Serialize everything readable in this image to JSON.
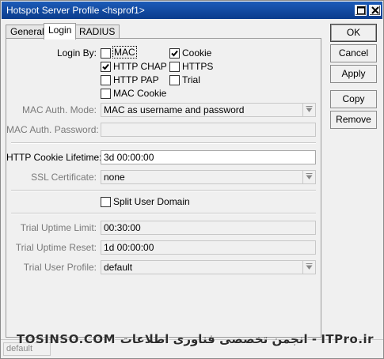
{
  "window": {
    "title": "Hotspot Server Profile <hsprof1>"
  },
  "tabs": [
    {
      "label": "General",
      "active": false
    },
    {
      "label": "Login",
      "active": true
    },
    {
      "label": "RADIUS",
      "active": false
    }
  ],
  "login_by": {
    "label": "Login By:",
    "options": [
      {
        "label": "MAC",
        "checked": false
      },
      {
        "label": "Cookie",
        "checked": true
      },
      {
        "label": "HTTP CHAP",
        "checked": true
      },
      {
        "label": "HTTPS",
        "checked": false
      },
      {
        "label": "HTTP PAP",
        "checked": false
      },
      {
        "label": "Trial",
        "checked": false
      },
      {
        "label": "MAC Cookie",
        "checked": false
      }
    ]
  },
  "mac_auth_mode": {
    "label": "MAC Auth. Mode:",
    "value": "MAC as username and password"
  },
  "mac_auth_password": {
    "label": "MAC Auth. Password:",
    "value": ""
  },
  "http_cookie_lifetime": {
    "label": "HTTP Cookie Lifetime:",
    "value": "3d 00:00:00"
  },
  "ssl_certificate": {
    "label": "SSL Certificate:",
    "value": "none"
  },
  "split_user_domain": {
    "label": "Split User Domain",
    "checked": false
  },
  "trial_uptime_limit": {
    "label": "Trial Uptime Limit:",
    "value": "00:30:00"
  },
  "trial_uptime_reset": {
    "label": "Trial Uptime Reset:",
    "value": "1d 00:00:00"
  },
  "trial_user_profile": {
    "label": "Trial User Profile:",
    "value": "default"
  },
  "buttons": {
    "ok": "OK",
    "cancel": "Cancel",
    "apply": "Apply",
    "copy": "Copy",
    "remove": "Remove"
  },
  "status": {
    "text": "default"
  },
  "watermark": {
    "text": "TOSINSO.COM انجمن تخصصی فناوری اطلاعات - ITPro.ir"
  },
  "colors": {
    "titlebar": "#0b3c8c",
    "titlebar_text": "#ffffff",
    "panel": "#f0f0f0"
  }
}
